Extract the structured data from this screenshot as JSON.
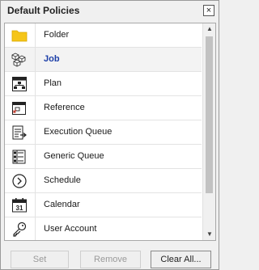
{
  "dialog": {
    "title": "Default Policies",
    "close_glyph": "×"
  },
  "list": {
    "selected_index": 1,
    "items": [
      {
        "label": "Folder",
        "icon": "folder-icon"
      },
      {
        "label": "Job",
        "icon": "job-cubes-icon"
      },
      {
        "label": "Plan",
        "icon": "plan-icon"
      },
      {
        "label": "Reference",
        "icon": "reference-icon"
      },
      {
        "label": "Execution Queue",
        "icon": "execution-queue-icon"
      },
      {
        "label": "Generic Queue",
        "icon": "generic-queue-icon"
      },
      {
        "label": "Schedule",
        "icon": "schedule-icon"
      },
      {
        "label": "Calendar",
        "icon": "calendar-icon"
      },
      {
        "label": "User Account",
        "icon": "key-icon"
      }
    ],
    "calendar_icon_day": "31"
  },
  "scrollbar": {
    "up_glyph": "▲",
    "down_glyph": "▼"
  },
  "buttons": {
    "set_label": "Set",
    "remove_label": "Remove",
    "clear_all_label": "Clear All..."
  },
  "colors": {
    "selected_text": "#1c3fa8",
    "folder": "#f5c518"
  }
}
